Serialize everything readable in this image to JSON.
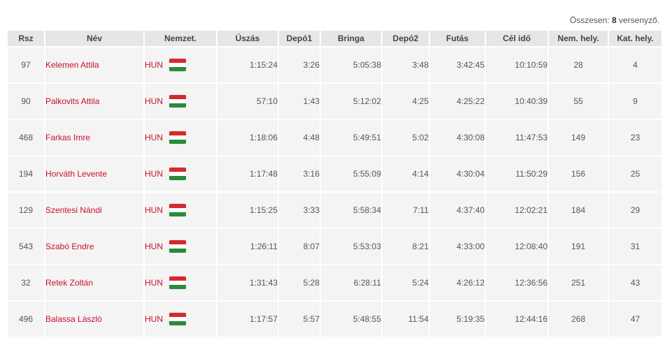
{
  "summary": {
    "prefix": "Összesen:",
    "count": "8",
    "suffix": "versenyző."
  },
  "columns": {
    "rsz": "Rsz",
    "nev": "Név",
    "nemzet": "Nemzet.",
    "uszas": "Úszás",
    "depo1": "Depó1",
    "bringa": "Bringa",
    "depo2": "Depó2",
    "futas": "Futás",
    "celido": "Cél idő",
    "nemhely": "Nem. hely.",
    "kathely": "Kat. hely."
  },
  "rows": [
    {
      "rsz": "97",
      "nev": "Kelemen Attila",
      "nemzet": "HUN",
      "uszas": "1:15:24",
      "depo1": "3:26",
      "bringa": "5:05:38",
      "depo2": "3:48",
      "futas": "3:42:45",
      "celido": "10:10:59",
      "nemhely": "28",
      "kathely": "4"
    },
    {
      "rsz": "90",
      "nev": "Palkovits Attila",
      "nemzet": "HUN",
      "uszas": "57:10",
      "depo1": "1:43",
      "bringa": "5:12:02",
      "depo2": "4:25",
      "futas": "4:25:22",
      "celido": "10:40:39",
      "nemhely": "55",
      "kathely": "9"
    },
    {
      "rsz": "468",
      "nev": "Farkas Imre",
      "nemzet": "HUN",
      "uszas": "1:18:06",
      "depo1": "4:48",
      "bringa": "5:49:51",
      "depo2": "5:02",
      "futas": "4:30:08",
      "celido": "11:47:53",
      "nemhely": "149",
      "kathely": "23"
    },
    {
      "rsz": "194",
      "nev": "Horváth Levente",
      "nemzet": "HUN",
      "uszas": "1:17:48",
      "depo1": "3:16",
      "bringa": "5:55:09",
      "depo2": "4:14",
      "futas": "4:30:04",
      "celido": "11:50:29",
      "nemhely": "156",
      "kathely": "25"
    },
    {
      "rsz": "129",
      "nev": "Szentesi Nándi",
      "nemzet": "HUN",
      "uszas": "1:15:25",
      "depo1": "3:33",
      "bringa": "5:58:34",
      "depo2": "7:11",
      "futas": "4:37:40",
      "celido": "12:02:21",
      "nemhely": "184",
      "kathely": "29"
    },
    {
      "rsz": "543",
      "nev": "Szabó Endre",
      "nemzet": "HUN",
      "uszas": "1:26:11",
      "depo1": "8:07",
      "bringa": "5:53:03",
      "depo2": "8:21",
      "futas": "4:33:00",
      "celido": "12:08:40",
      "nemhely": "191",
      "kathely": "31"
    },
    {
      "rsz": "32",
      "nev": "Retek Zoltán",
      "nemzet": "HUN",
      "uszas": "1:31:43",
      "depo1": "5:28",
      "bringa": "6:28:11",
      "depo2": "5:24",
      "futas": "4:26:12",
      "celido": "12:36:56",
      "nemhely": "251",
      "kathely": "43"
    },
    {
      "rsz": "496",
      "nev": "Balassa László",
      "nemzet": "HUN",
      "uszas": "1:17:57",
      "depo1": "5:57",
      "bringa": "5:48:55",
      "depo2": "11:54",
      "futas": "5:19:35",
      "celido": "12:44:16",
      "nemhely": "268",
      "kathely": "47"
    }
  ],
  "flag_icon": "hungary-flag-icon",
  "colors": {
    "link": "#c8102e",
    "header_bg": "#e6e6e6",
    "row_bg": "#f4f4f4",
    "flag_red": "#d62a2a",
    "flag_white": "#ffffff",
    "flag_green": "#2a8a3a"
  }
}
